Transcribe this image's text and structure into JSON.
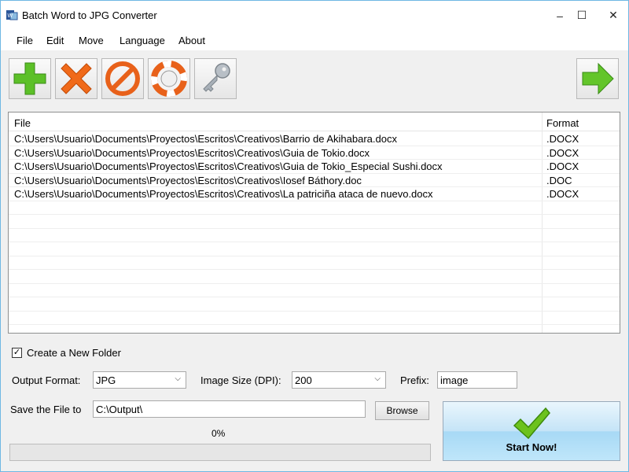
{
  "window": {
    "title": "Batch Word to JPG Converter",
    "controls": {
      "minimize": "–",
      "maximize": "☐",
      "close": "✕"
    }
  },
  "menu": [
    "File",
    "Edit",
    "Move",
    "Language",
    "About"
  ],
  "toolbar": {
    "buttons": [
      "add-icon",
      "remove-icon",
      "clear-icon",
      "help-lifebuoy-icon",
      "key-icon"
    ],
    "next": "arrow-right-icon"
  },
  "list": {
    "headers": {
      "file": "File",
      "format": "Format"
    },
    "rows": [
      {
        "file": "C:\\Users\\Usuario\\Documents\\Proyectos\\Escritos\\Creativos\\Barrio de Akihabara.docx",
        "format": ".DOCX"
      },
      {
        "file": "C:\\Users\\Usuario\\Documents\\Proyectos\\Escritos\\Creativos\\Guia de Tokio.docx",
        "format": ".DOCX"
      },
      {
        "file": "C:\\Users\\Usuario\\Documents\\Proyectos\\Escritos\\Creativos\\Guia de Tokio_Especial Sushi.docx",
        "format": ".DOCX"
      },
      {
        "file": "C:\\Users\\Usuario\\Documents\\Proyectos\\Escritos\\Creativos\\Iosef Báthory.doc",
        "format": ".DOC"
      },
      {
        "file": "C:\\Users\\Usuario\\Documents\\Proyectos\\Escritos\\Creativos\\La patriciña ataca de nuevo.docx",
        "format": ".DOCX"
      },
      {
        "file": "",
        "format": ""
      },
      {
        "file": "",
        "format": ""
      },
      {
        "file": "",
        "format": ""
      },
      {
        "file": "",
        "format": ""
      },
      {
        "file": "",
        "format": ""
      },
      {
        "file": "",
        "format": ""
      },
      {
        "file": "",
        "format": ""
      },
      {
        "file": "",
        "format": ""
      },
      {
        "file": "",
        "format": ""
      }
    ]
  },
  "options": {
    "create_folder_label": "Create a New Folder",
    "create_folder_checked": true,
    "output_format_label": "Output Format:",
    "output_format_value": "JPG",
    "image_size_label": "Image Size (DPI):",
    "image_size_value": "200",
    "prefix_label": "Prefix:",
    "prefix_value": "image",
    "save_label": "Save the File to",
    "save_path": "C:\\Output\\",
    "browse_label": "Browse"
  },
  "progress": {
    "text": "0%",
    "fraction": 0
  },
  "start_label": "Start Now!"
}
